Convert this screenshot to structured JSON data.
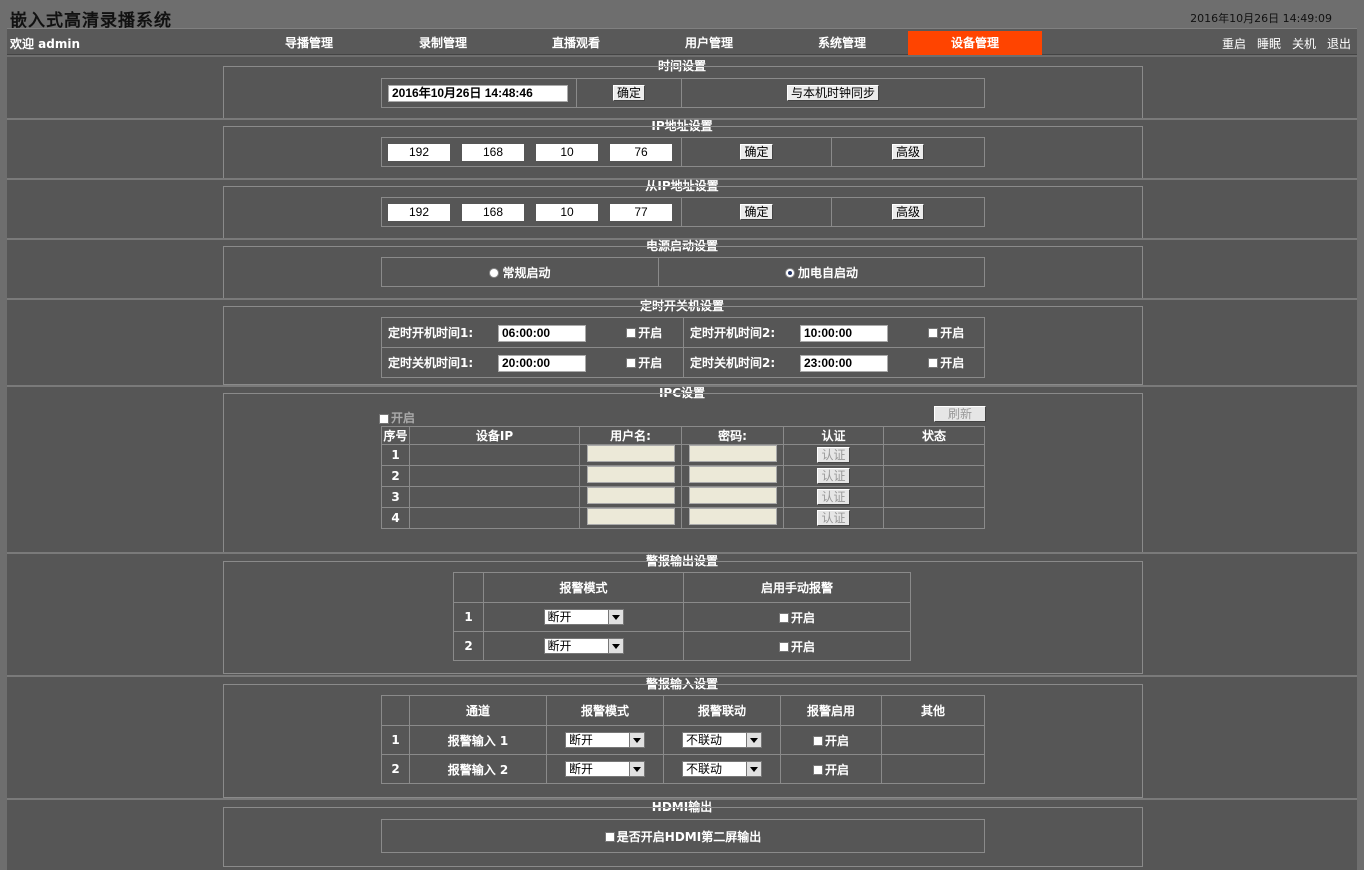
{
  "header": {
    "app_title": "嵌入式高清录播系统",
    "datetime": "2016年10月26日 14:49:09"
  },
  "navbar": {
    "welcome": "欢迎 admin",
    "items": [
      "导播管理",
      "录制管理",
      "直播观看",
      "用户管理",
      "系统管理",
      "设备管理"
    ],
    "active_index": 5,
    "active_color": "#ff4400",
    "system_links": [
      "重启",
      "睡眠",
      "关机",
      "退出"
    ]
  },
  "time_settings": {
    "title": "时间设置",
    "value": "2016年10月26日 14:48:46",
    "confirm": "确定",
    "sync": "与本机时钟同步"
  },
  "ip_settings": {
    "title": "IP地址设置",
    "octets": [
      "192",
      "168",
      "10",
      "76"
    ],
    "confirm": "确定",
    "advanced": "高级"
  },
  "slave_ip_settings": {
    "title": "从IP地址设置",
    "octets": [
      "192",
      "168",
      "10",
      "77"
    ],
    "confirm": "确定",
    "advanced": "高级"
  },
  "power_settings": {
    "title": "电源启动设置",
    "option_normal": "常规启动",
    "option_auto": "加电自启动",
    "selected": "加电自启动"
  },
  "timer_settings": {
    "title": "定时开关机设置",
    "on1_label": "定时开机时间1:",
    "on1_value": "06:00:00",
    "on2_label": "定时开机时间2:",
    "on2_value": "10:00:00",
    "off1_label": "定时关机时间1:",
    "off1_value": "20:00:00",
    "off2_label": "定时关机时间2:",
    "off2_value": "23:00:00",
    "enable": "开启"
  },
  "ipc_settings": {
    "title": "IPC设置",
    "enable": "开启",
    "refresh": "刷新",
    "headers": [
      "序号",
      "设备IP",
      "用户名:",
      "密码:",
      "认证",
      "状态"
    ],
    "rows": [
      "1",
      "2",
      "3",
      "4"
    ],
    "auth_button": "认证"
  },
  "alarm_output": {
    "title": "警报输出设置",
    "headers": [
      "报警模式",
      "启用手动报警"
    ],
    "rows": [
      {
        "index": "1",
        "mode": "断开",
        "enable": "开启"
      },
      {
        "index": "2",
        "mode": "断开",
        "enable": "开启"
      }
    ]
  },
  "alarm_input": {
    "title": "警报输入设置",
    "headers": [
      "通道",
      "报警模式",
      "报警联动",
      "报警启用",
      "其他"
    ],
    "rows": [
      {
        "index": "1",
        "channel": "报警输入 1",
        "mode": "断开",
        "link": "不联动",
        "enable": "开启"
      },
      {
        "index": "2",
        "channel": "报警输入 2",
        "mode": "断开",
        "link": "不联动",
        "enable": "开启"
      }
    ]
  },
  "hdmi_output": {
    "title": "HDMI输出",
    "option": "是否开启HDMI第二屏输出"
  }
}
